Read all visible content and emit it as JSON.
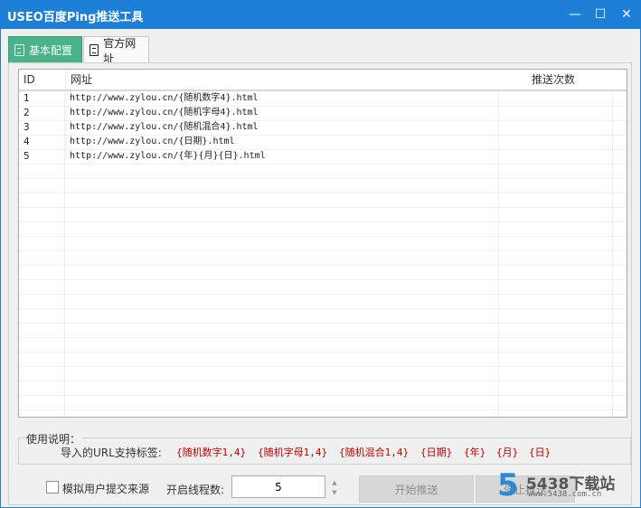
{
  "window": {
    "title": "USEO百度Ping推送工具",
    "minimize_glyph": "—",
    "maximize_glyph": "☐",
    "close_glyph": "✕"
  },
  "tabs": [
    {
      "label": "基本配置",
      "icon": "document-icon",
      "active": true
    },
    {
      "label": "官方网址",
      "icon": "document-icon",
      "active": false
    }
  ],
  "table": {
    "columns": [
      "ID",
      "网址",
      "推送次数"
    ],
    "rows": [
      {
        "id": "1",
        "url": "http://www.zylou.cn/{随机数字4}.html",
        "count": ""
      },
      {
        "id": "2",
        "url": "http://www.zylou.cn/{随机字母4}.html",
        "count": ""
      },
      {
        "id": "3",
        "url": "http://www.zylou.cn/{随机混合4}.html",
        "count": ""
      },
      {
        "id": "4",
        "url": "http://www.zylou.cn/{日期}.html",
        "count": ""
      },
      {
        "id": "5",
        "url": "http://www.zylou.cn/{年}{月}{日}.html",
        "count": ""
      }
    ]
  },
  "usage": {
    "legend": "使用说明：",
    "tags_label": "导入的URL支持标签:",
    "tags": [
      "{随机数字1,4}",
      "{随机字母1,4}",
      "{随机混合1,4}",
      "{日期}",
      "{年}",
      "{月}",
      "{日}"
    ],
    "tag_color": "#c00000"
  },
  "controls": {
    "simulate_label": "模拟用户提交来源",
    "threads_label": "开启线程数:",
    "threads_value": "5",
    "start_button": "开始推送",
    "stop_button": "停止推送"
  },
  "watermark": {
    "digit": "5",
    "name": "5438下载站",
    "url": "www.5438.com.cn"
  },
  "colors": {
    "titlebar": "#1e7fd6",
    "active_tab": "#49b38b"
  }
}
